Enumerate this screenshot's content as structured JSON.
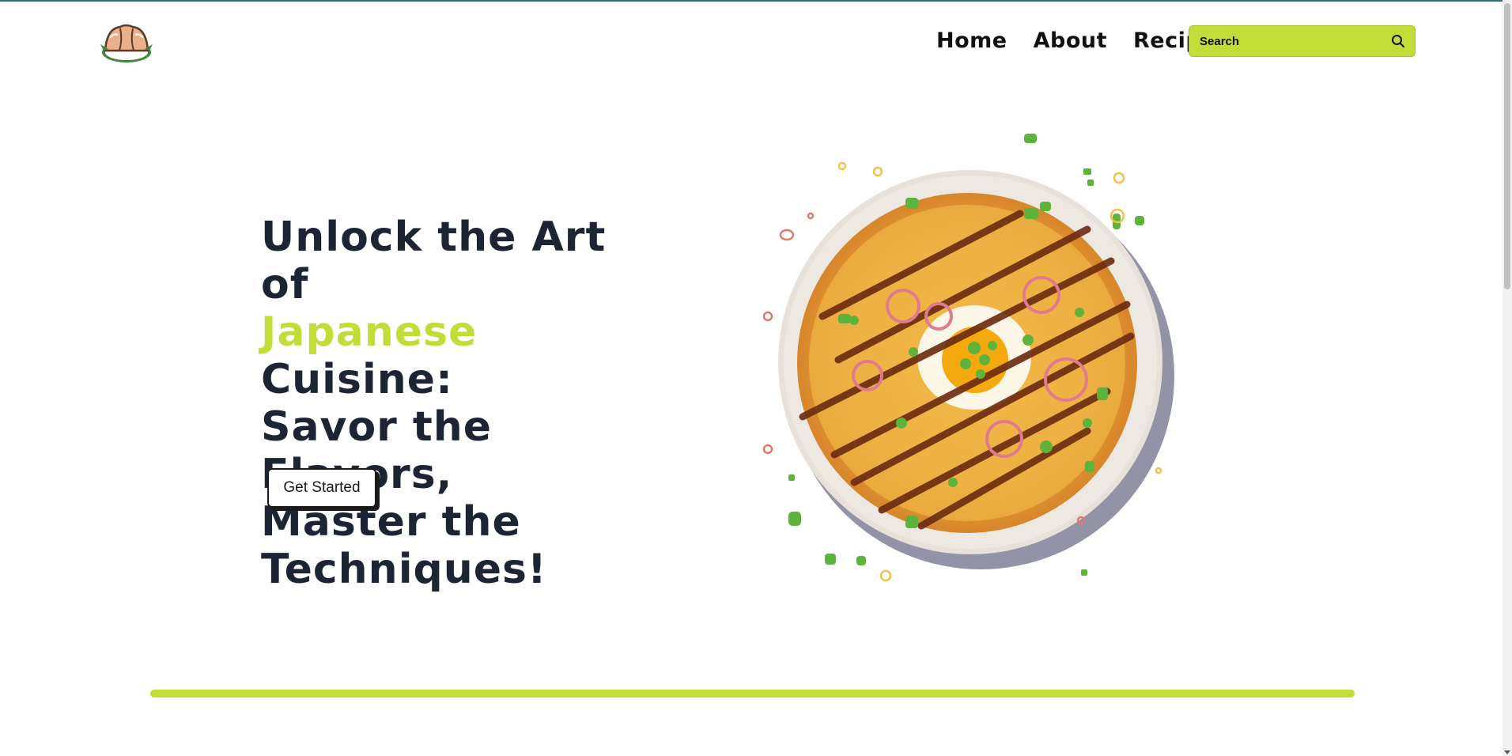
{
  "header": {
    "logo": "dumpling-logo",
    "nav": [
      "Home",
      "About",
      "Recipes"
    ],
    "search": {
      "placeholder": "Search",
      "icon": "search-icon"
    }
  },
  "hero": {
    "headline": {
      "line1": "Unlock the Art of",
      "accent": "Japanese",
      "line2_rest": " Cuisine:",
      "line3": "Savor the Flavors,",
      "line4": "Master the",
      "line5": "Techniques!"
    },
    "cta_label": "Get Started",
    "image": "okonomiyaki-plate-image"
  },
  "colors": {
    "accent": "#c2dd38",
    "heading": "#1d2535",
    "text": "#111111"
  }
}
